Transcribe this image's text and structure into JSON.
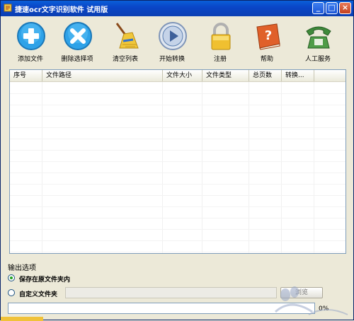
{
  "window": {
    "title": "捷速ocr文字识别软件 试用版"
  },
  "title_buttons": {
    "minimize": "_",
    "maximize": "□",
    "close": "×"
  },
  "toolbar": {
    "add": {
      "label": "添加文件",
      "icon": "plus-circle-icon",
      "color": "#2ea2e8"
    },
    "remove": {
      "label": "删除选择项",
      "icon": "x-circle-icon",
      "color": "#2ea2e8"
    },
    "clear": {
      "label": "清空列表",
      "icon": "broom-icon",
      "color": "#e8b830"
    },
    "start": {
      "label": "开始转换",
      "icon": "play-circle-icon",
      "color": "#5b7fb0"
    },
    "register": {
      "label": "注册",
      "icon": "lock-icon",
      "color": "#f0c030"
    },
    "help": {
      "label": "帮助",
      "icon": "help-book-icon",
      "color": "#e0602a"
    },
    "support": {
      "label": "人工服务",
      "icon": "telephone-icon",
      "color": "#3f8a3a"
    }
  },
  "file_table": {
    "columns": [
      "序号",
      "文件路径",
      "文件大小",
      "文件类型",
      "总页数",
      "转换..."
    ],
    "rows": []
  },
  "output": {
    "section_title": "输出选项",
    "option_same_folder": "保存在原文件夹内",
    "option_custom_folder": "自定义文件夹",
    "selected": "option_same_folder",
    "custom_path": "",
    "browse_label": "浏览"
  },
  "progress": {
    "percent_label": "0%",
    "value": 0
  }
}
